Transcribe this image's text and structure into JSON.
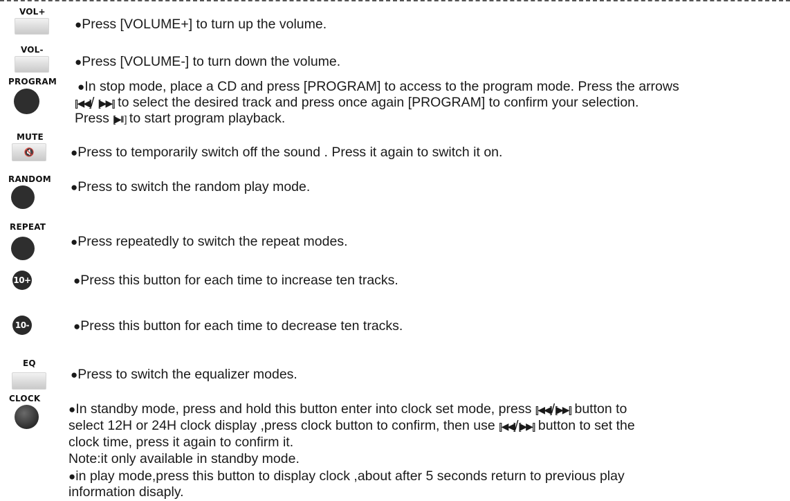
{
  "buttons": {
    "vol_up": "VOL+",
    "vol_down": "VOL-",
    "program": "PROGRAM",
    "mute": "MUTE",
    "random": "RANDOM",
    "repeat": "REPEAT",
    "ten_plus": "10+",
    "ten_minus": "10-",
    "eq": "EQ",
    "clock": "CLOCK"
  },
  "glyphs": {
    "bullet": "●",
    "prev": "[|◀◀]",
    "next": "[▶▶|]",
    "play_pause": "[▶II ]",
    "mute_icon": "🔇"
  },
  "descriptions": {
    "vol_up": "Press [VOLUME+] to turn up the volume.",
    "vol_down": "Press [VOLUME-] to turn down the volume.",
    "program_line1": "In stop mode, place a CD and press [PROGRAM] to access to the program mode. Press the arrows",
    "program_line2_post": " to select the desired track and press once again [PROGRAM] to confirm your selection.",
    "program_line3_pre": "Press ",
    "program_line3_post": " to start program playback.",
    "mute": "Press to temporarily switch off the sound . Press it again to switch it on.",
    "random": "Press to switch the random play mode.",
    "repeat": "Press repeatedly to switch the repeat modes.",
    "ten_plus": "Press this button for each time to increase ten tracks.",
    "ten_minus": "Press this button for each time to decrease ten tracks.",
    "eq": "Press to switch the equalizer modes.",
    "clock_line1_pre": "In standby mode, press and hold this button enter into clock set mode,  press ",
    "clock_line1_post": " button to",
    "clock_line2_pre": "select 12H or 24H clock display ,press clock button to confirm, then use ",
    "clock_line2_post": " button to set the",
    "clock_line3": "clock time, press it again to confirm it.",
    "clock_note": "Note:it only available in standby mode.",
    "clock_play_line1": "in play mode,press this button to display clock ,about after 5 seconds return to previous play",
    "clock_play_line2": "information disaply."
  }
}
